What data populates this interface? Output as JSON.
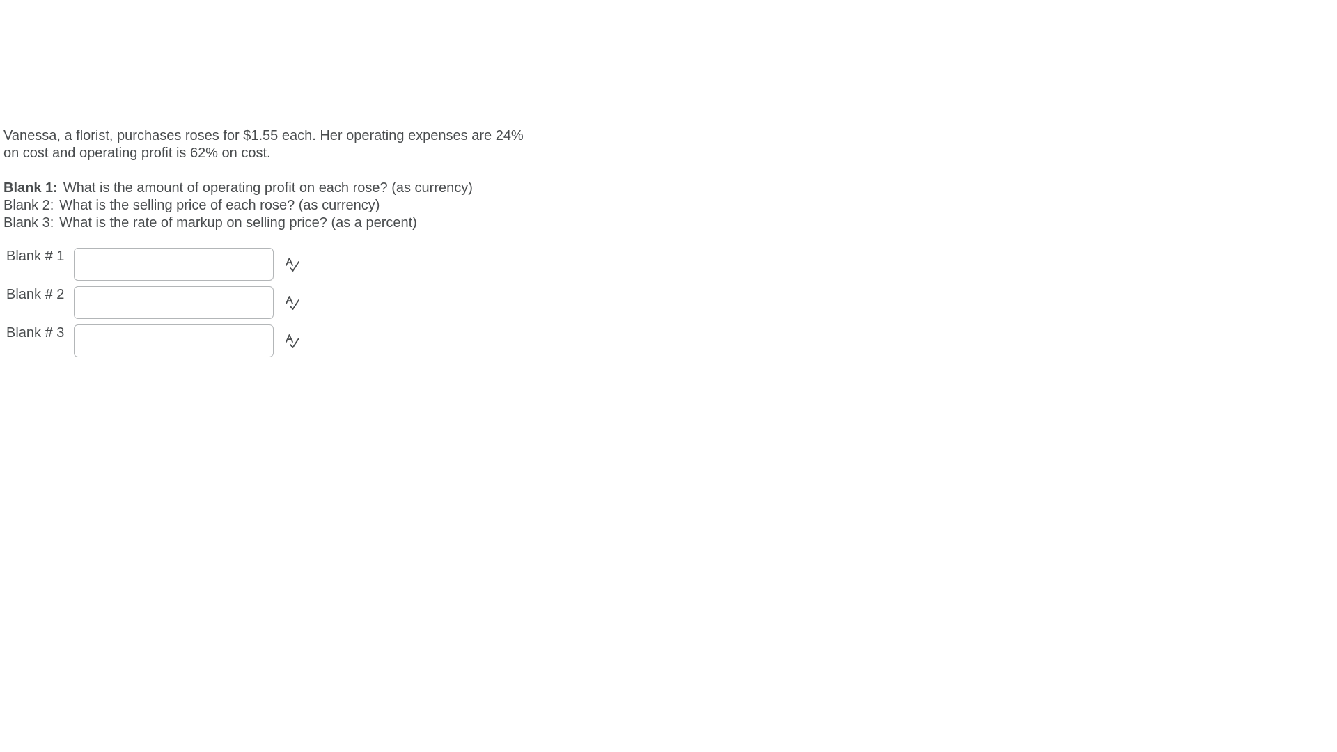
{
  "question": {
    "problem_line1": "Vanessa, a florist, purchases roses for $1.55 each. Her operating expenses are 24%",
    "problem_line2": "on cost and operating profit is 62% on cost.",
    "prompts": [
      {
        "label": "Blank 1:",
        "text": "What is the amount of operating profit on each rose? (as currency)"
      },
      {
        "label": "Blank 2:",
        "text": "What is the selling price of each rose? (as currency)"
      },
      {
        "label": "Blank 3:",
        "text": "What is the rate of markup on selling price?  (as a percent)"
      }
    ]
  },
  "blanks": [
    {
      "label": "Blank # 1",
      "value": "",
      "placeholder": ""
    },
    {
      "label": "Blank # 2",
      "value": "",
      "placeholder": ""
    },
    {
      "label": "Blank # 3",
      "value": "",
      "placeholder": ""
    }
  ],
  "icons": {
    "answer_check": "spellcheck-icon"
  },
  "colors": {
    "text": "#494c4e",
    "input_border": "#b3b6b8",
    "divider": "#8f9396"
  }
}
